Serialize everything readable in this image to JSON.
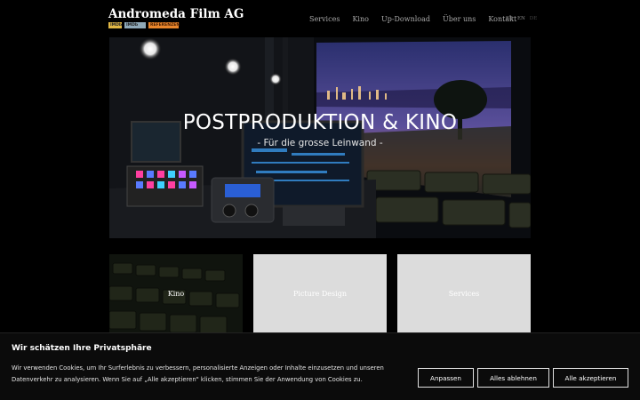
{
  "header": {
    "logo": "Andromeda Film AG",
    "badges": [
      "IMDb",
      "IMDb",
      "REFERENZEN"
    ],
    "nav": [
      "Services",
      "Kino",
      "Up-Download",
      "Über uns",
      "Kontakt"
    ],
    "languages": [
      "FR",
      "EN",
      "DE"
    ]
  },
  "hero": {
    "title": "POSTPRODUKTION & KINO",
    "subtitle": "- Für die grosse Leinwand -"
  },
  "tiles": [
    "Kino",
    "Picture Design",
    "Services"
  ],
  "cookie": {
    "heading": "Wir schätzen Ihre Privatsphäre",
    "text": "Wir verwenden Cookies, um Ihr Surferlebnis zu verbessern, personalisierte Anzeigen oder Inhalte einzusetzen und unseren Datenverkehr zu analysieren. Wenn Sie auf „Alle akzeptieren\" klicken, stimmen Sie der Anwendung von Cookies zu.",
    "buttons": {
      "customize": "Anpassen",
      "reject": "Alles ablehnen",
      "accept": "Alle akzeptieren"
    }
  }
}
